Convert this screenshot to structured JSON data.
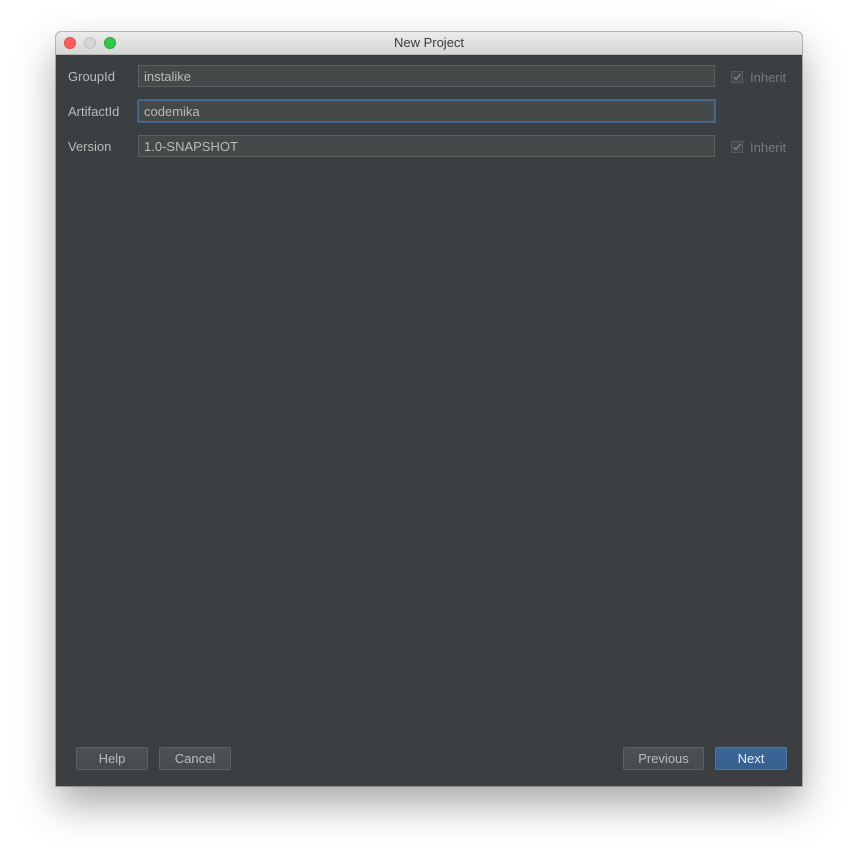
{
  "window": {
    "title": "New Project"
  },
  "form": {
    "group_id": {
      "label": "GroupId",
      "value": "instalike",
      "inherit_label": "Inherit",
      "inherit_checked": true
    },
    "artifact_id": {
      "label": "ArtifactId",
      "value": "codemika"
    },
    "version": {
      "label": "Version",
      "value": "1.0-SNAPSHOT",
      "inherit_label": "Inherit",
      "inherit_checked": true
    }
  },
  "buttons": {
    "help": "Help",
    "cancel": "Cancel",
    "previous": "Previous",
    "next": "Next"
  },
  "colors": {
    "background": "#3c3f41",
    "field_background": "#45494a",
    "focus_border": "#466d94",
    "primary_button": "#365f8d",
    "text": "#bbbbbb"
  }
}
